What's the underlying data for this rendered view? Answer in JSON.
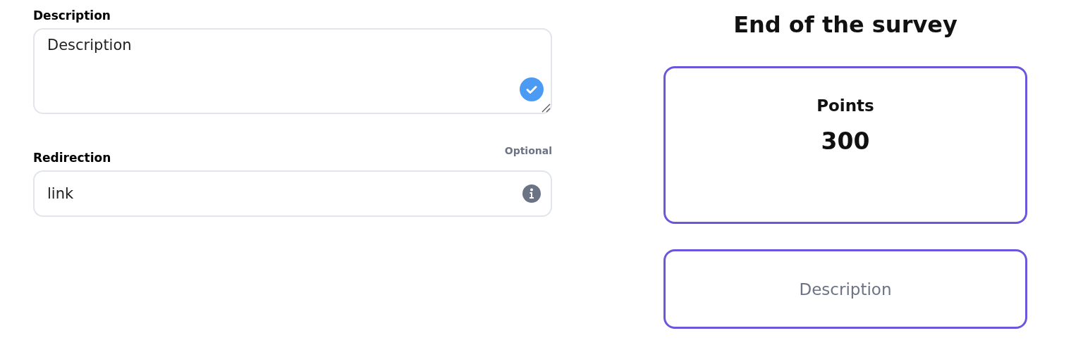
{
  "form": {
    "fields": [
      {
        "kind": "textarea",
        "label": "Description",
        "value": "Description",
        "valid": true
      },
      {
        "kind": "input",
        "label": "Redirection",
        "hint": "Optional",
        "value": "link",
        "info": true
      }
    ]
  },
  "preview": {
    "title": "End of the survey",
    "points_card": {
      "label": "Points",
      "value": "300"
    },
    "description_card": {
      "text": "Description"
    }
  }
}
